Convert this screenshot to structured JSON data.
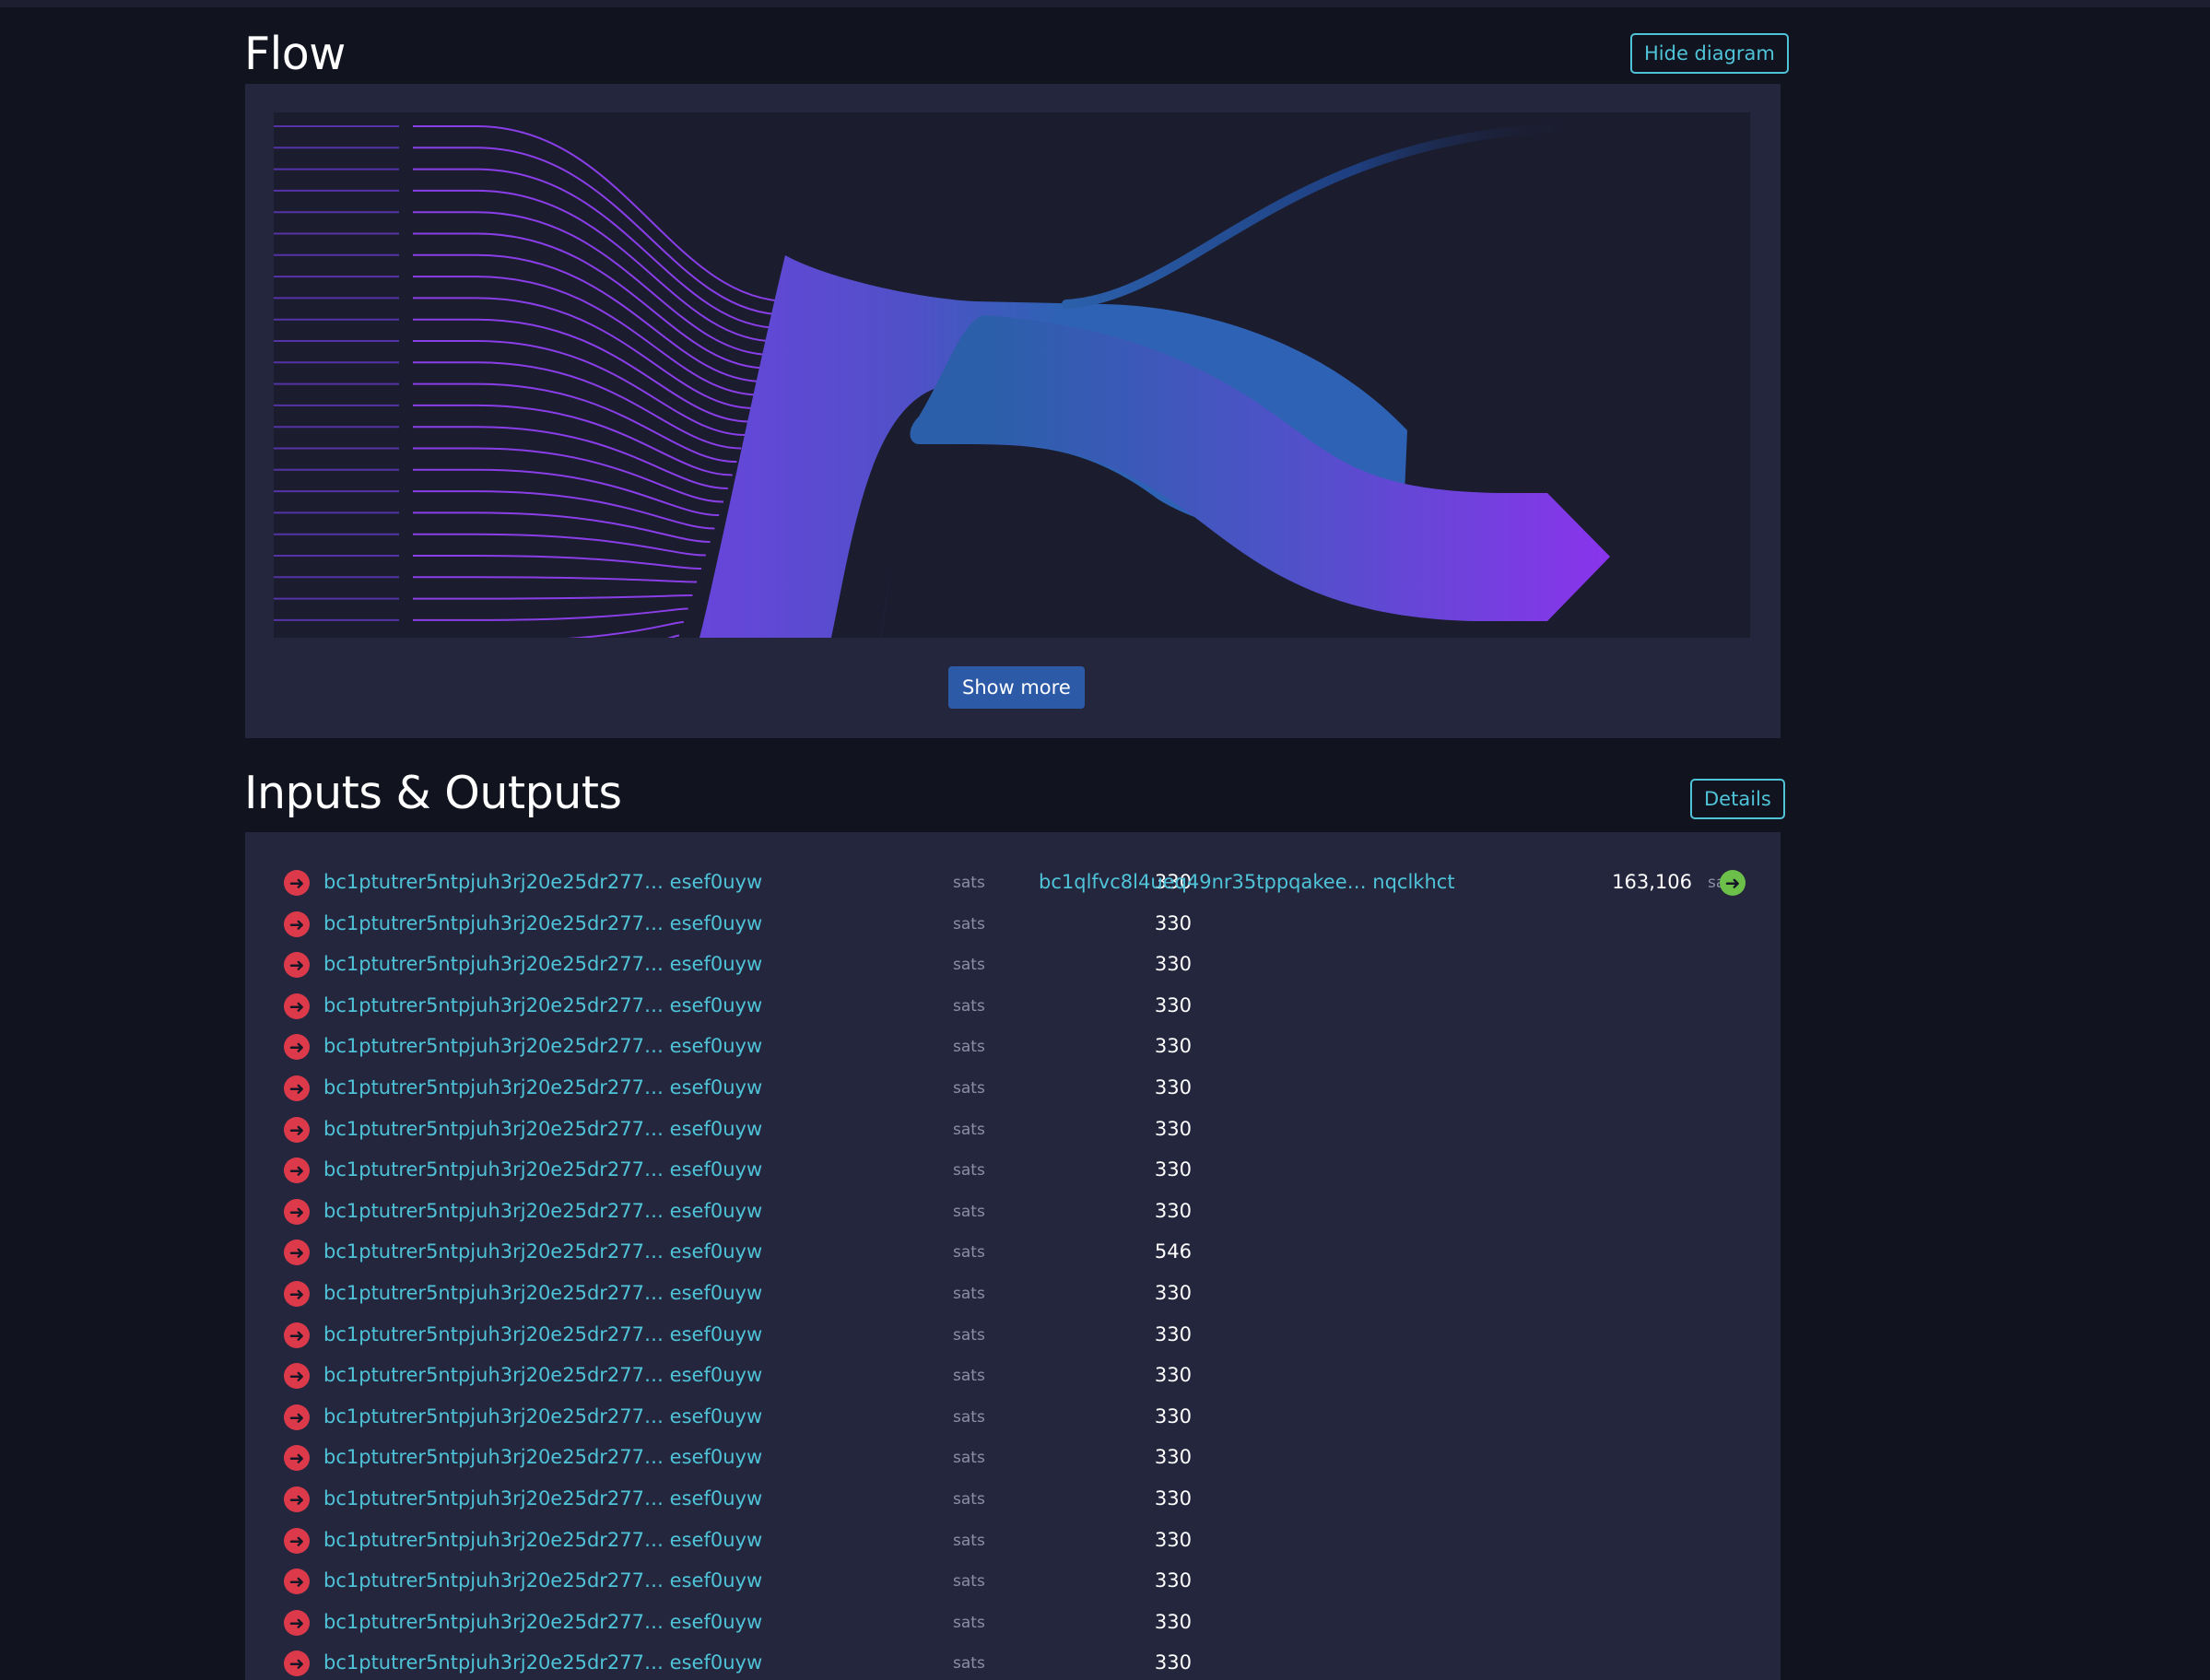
{
  "flow": {
    "title": "Flow",
    "hide_diagram_label": "Hide diagram",
    "show_more_label": "Show more",
    "colors": {
      "input_stroke": "#8a3ee8",
      "mid_blue": "#2b5faa",
      "output": "#8a34ec",
      "change": "#1c3a7a"
    }
  },
  "io": {
    "title": "Inputs & Outputs",
    "details_label": "Details",
    "unit": "sats",
    "inputs": [
      {
        "address": "bc1ptutrer5ntpjuh3rj20e25dr277… esef0uyw",
        "amount": "330"
      },
      {
        "address": "bc1ptutrer5ntpjuh3rj20e25dr277… esef0uyw",
        "amount": "330"
      },
      {
        "address": "bc1ptutrer5ntpjuh3rj20e25dr277… esef0uyw",
        "amount": "330"
      },
      {
        "address": "bc1ptutrer5ntpjuh3rj20e25dr277… esef0uyw",
        "amount": "330"
      },
      {
        "address": "bc1ptutrer5ntpjuh3rj20e25dr277… esef0uyw",
        "amount": "330"
      },
      {
        "address": "bc1ptutrer5ntpjuh3rj20e25dr277… esef0uyw",
        "amount": "330"
      },
      {
        "address": "bc1ptutrer5ntpjuh3rj20e25dr277… esef0uyw",
        "amount": "330"
      },
      {
        "address": "bc1ptutrer5ntpjuh3rj20e25dr277… esef0uyw",
        "amount": "330"
      },
      {
        "address": "bc1ptutrer5ntpjuh3rj20e25dr277… esef0uyw",
        "amount": "330"
      },
      {
        "address": "bc1ptutrer5ntpjuh3rj20e25dr277… esef0uyw",
        "amount": "546"
      },
      {
        "address": "bc1ptutrer5ntpjuh3rj20e25dr277… esef0uyw",
        "amount": "330"
      },
      {
        "address": "bc1ptutrer5ntpjuh3rj20e25dr277… esef0uyw",
        "amount": "330"
      },
      {
        "address": "bc1ptutrer5ntpjuh3rj20e25dr277… esef0uyw",
        "amount": "330"
      },
      {
        "address": "bc1ptutrer5ntpjuh3rj20e25dr277… esef0uyw",
        "amount": "330"
      },
      {
        "address": "bc1ptutrer5ntpjuh3rj20e25dr277… esef0uyw",
        "amount": "330"
      },
      {
        "address": "bc1ptutrer5ntpjuh3rj20e25dr277… esef0uyw",
        "amount": "330"
      },
      {
        "address": "bc1ptutrer5ntpjuh3rj20e25dr277… esef0uyw",
        "amount": "330"
      },
      {
        "address": "bc1ptutrer5ntpjuh3rj20e25dr277… esef0uyw",
        "amount": "330"
      },
      {
        "address": "bc1ptutrer5ntpjuh3rj20e25dr277… esef0uyw",
        "amount": "330"
      },
      {
        "address": "bc1ptutrer5ntpjuh3rj20e25dr277… esef0uyw",
        "amount": "330"
      }
    ],
    "outputs": [
      {
        "address": "bc1qlfvc8l4ueq49nr35tppqakee… nqclkhct",
        "amount": "163,106"
      }
    ],
    "icons": {
      "input": "arrow-right-circle-icon",
      "output": "arrow-right-circle-icon"
    }
  }
}
